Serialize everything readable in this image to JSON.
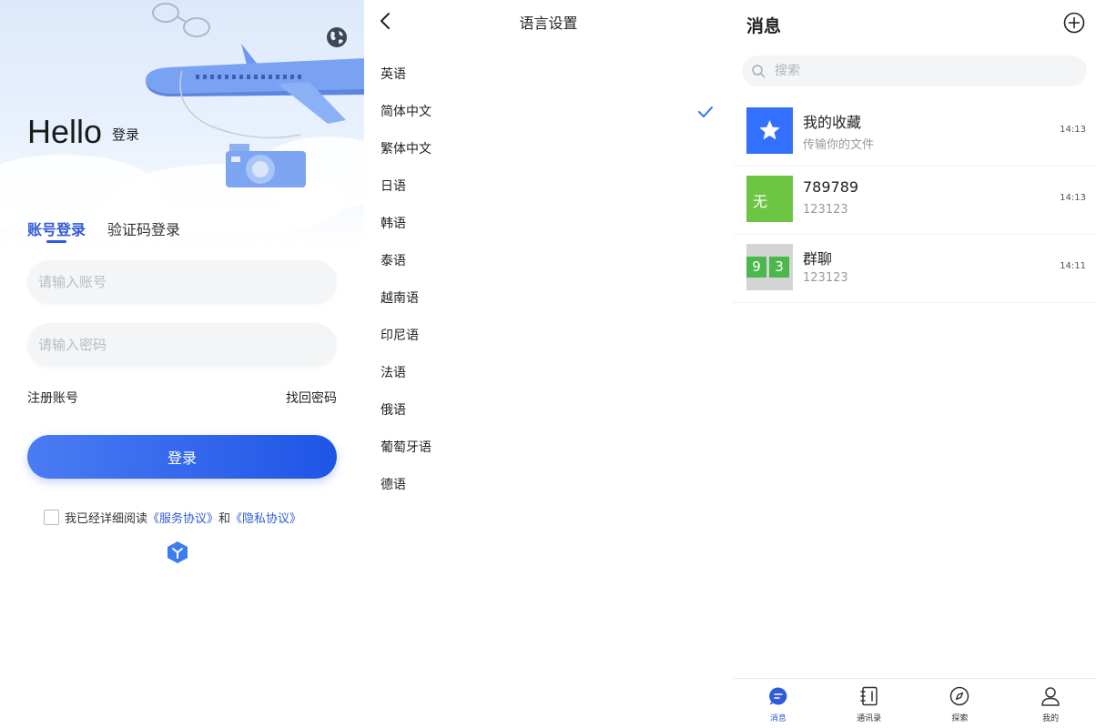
{
  "login": {
    "hero_title": "Hello",
    "hero_subtitle": "登录",
    "tabs": [
      {
        "label": "账号登录",
        "active": true
      },
      {
        "label": "验证码登录",
        "active": false
      }
    ],
    "account_placeholder": "请输入账号",
    "password_placeholder": "请输入密码",
    "register_label": "注册账号",
    "forgot_label": "找回密码",
    "login_button": "登录",
    "agree_prefix": "我已经详细阅读",
    "service_agreement": "《服务协议》",
    "agree_and": "和",
    "privacy_agreement": "《隐私协议》",
    "accent_color": "#2f5bd8"
  },
  "language": {
    "title": "语言设置",
    "items": [
      {
        "label": "英语",
        "selected": false
      },
      {
        "label": "简体中文",
        "selected": true
      },
      {
        "label": "繁体中文",
        "selected": false
      },
      {
        "label": "日语",
        "selected": false
      },
      {
        "label": "韩语",
        "selected": false
      },
      {
        "label": "泰语",
        "selected": false
      },
      {
        "label": "越南语",
        "selected": false
      },
      {
        "label": "印尼语",
        "selected": false
      },
      {
        "label": "法语",
        "selected": false
      },
      {
        "label": "俄语",
        "selected": false
      },
      {
        "label": "葡萄牙语",
        "selected": false
      },
      {
        "label": "德语",
        "selected": false
      }
    ]
  },
  "messages": {
    "title": "消息",
    "search_placeholder": "搜索",
    "conversations": [
      {
        "name": "我的收藏",
        "subtitle": "传输你的文件",
        "time": "14:13",
        "avatar": "star-icon",
        "avatar_color": "#3370ff"
      },
      {
        "name": "789789",
        "subtitle": "123123",
        "time": "14:13",
        "avatar_text": "无",
        "avatar_color": "#6cc644"
      },
      {
        "name": "群聊",
        "subtitle": "123123",
        "time": "14:11",
        "avatar_digits": [
          "9",
          "3"
        ],
        "avatar_color": "#4cb84c"
      }
    ],
    "tabbar": [
      {
        "label": "消息",
        "icon": "chat-icon",
        "active": true
      },
      {
        "label": "通讯录",
        "icon": "contacts-icon",
        "active": false
      },
      {
        "label": "探索",
        "icon": "compass-icon",
        "active": false
      },
      {
        "label": "我的",
        "icon": "user-icon",
        "active": false
      }
    ]
  }
}
